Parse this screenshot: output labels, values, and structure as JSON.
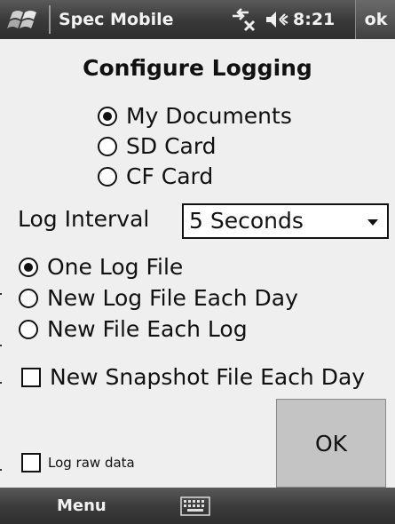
{
  "titlebar": {
    "app_title": "Spec Mobile",
    "time": "8:21",
    "ok_label": "ok"
  },
  "dialog": {
    "heading": "Configure Logging",
    "storage_options": [
      {
        "label": "My Documents",
        "selected": true
      },
      {
        "label": "SD Card",
        "selected": false
      },
      {
        "label": "CF Card",
        "selected": false
      }
    ],
    "log_interval_label": "Log Interval",
    "log_interval_value": "5 Seconds",
    "file_options": [
      {
        "label": "One Log File",
        "selected": true
      },
      {
        "label": "New Log File Each Day",
        "selected": false
      },
      {
        "label": "New File Each Log",
        "selected": false
      }
    ],
    "snapshot_label": "New Snapshot File Each Day",
    "snapshot_checked": false,
    "ok_button": "OK",
    "raw_data_label": "Log raw data",
    "raw_data_checked": false
  },
  "menubar": {
    "menu_label": "Menu"
  },
  "icons": {
    "start": "windows-flag-icon",
    "connectivity": "connectivity-icon",
    "volume": "volume-icon",
    "keyboard": "keyboard-icon"
  }
}
